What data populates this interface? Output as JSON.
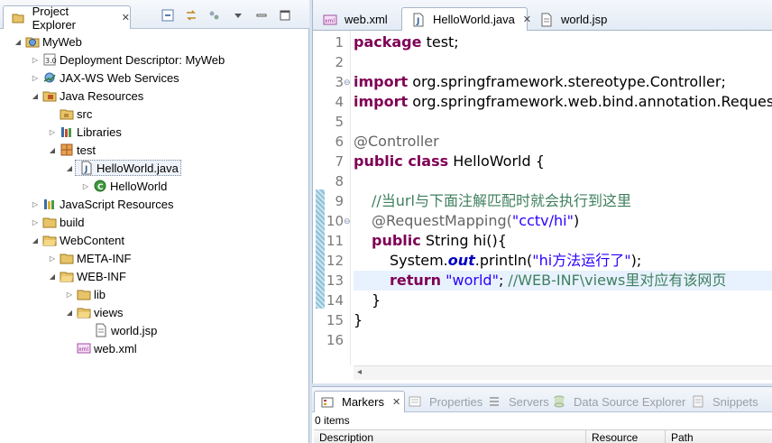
{
  "explorer": {
    "tab_title": "Project Explorer",
    "tree": [
      {
        "label": "MyWeb",
        "icon": "web-project-icon"
      },
      {
        "label": "Deployment Descriptor: MyWeb",
        "icon": "deployment-descriptor-icon"
      },
      {
        "label": "JAX-WS Web Services",
        "icon": "web-services-icon"
      },
      {
        "label": "Java Resources",
        "icon": "java-resources-icon"
      },
      {
        "label": "src",
        "icon": "source-folder-icon"
      },
      {
        "label": "Libraries",
        "icon": "libraries-icon"
      },
      {
        "label": "test",
        "icon": "package-icon"
      },
      {
        "label": "HelloWorld.java",
        "icon": "java-file-icon"
      },
      {
        "label": "HelloWorld",
        "icon": "class-icon"
      },
      {
        "label": "JavaScript Resources",
        "icon": "javascript-resources-icon"
      },
      {
        "label": "build",
        "icon": "folder-icon"
      },
      {
        "label": "WebContent",
        "icon": "folder-icon"
      },
      {
        "label": "META-INF",
        "icon": "folder-icon"
      },
      {
        "label": "WEB-INF",
        "icon": "folder-icon"
      },
      {
        "label": "lib",
        "icon": "folder-icon"
      },
      {
        "label": "views",
        "icon": "folder-icon"
      },
      {
        "label": "world.jsp",
        "icon": "jsp-file-icon"
      },
      {
        "label": "web.xml",
        "icon": "xml-file-icon"
      }
    ]
  },
  "editor": {
    "tabs": [
      {
        "label": "web.xml",
        "icon": "xml-file-icon"
      },
      {
        "label": "HelloWorld.java",
        "icon": "java-file-icon"
      },
      {
        "label": "world.jsp",
        "icon": "jsp-file-icon"
      }
    ],
    "line_numbers": [
      "1",
      "2",
      "3",
      "4",
      "5",
      "6",
      "7",
      "8",
      "9",
      "10",
      "11",
      "12",
      "13",
      "14",
      "15",
      "16"
    ],
    "code": {
      "l1_kw": "package",
      "l1_rest": " test;",
      "l3_kw": "import",
      "l3_rest": " org.springframework.stereotype.Controller;",
      "l4_kw": "import",
      "l4_rest": " org.springframework.web.bind.annotation.RequestMapping;",
      "l6_ann": "@Controller",
      "l7_kw": "public class",
      "l7_rest": " HelloWorld {",
      "l9_cmt": "//当url与下面注解匹配时就会执行到这里",
      "l10_ann": "@RequestMapping(",
      "l10_str": "\"cctv/hi\"",
      "l10_end": ")",
      "l11_kw": "public",
      "l11_rest": " String hi(){",
      "l12_pre": "System.",
      "l12_fld": "out",
      "l12_mid": ".println(",
      "l12_str": "\"hi方法运行了\"",
      "l12_end": ");",
      "l13_kw": "return",
      "l13_sp": " ",
      "l13_str": "\"world\"",
      "l13_semi": "; ",
      "l13_cmt": "//WEB-INF\\views里对应有该网页",
      "l14": "}",
      "l15": "}"
    }
  },
  "bottom": {
    "tabs": [
      {
        "label": "Markers",
        "icon": "markers-icon"
      },
      {
        "label": "Properties",
        "icon": "properties-icon"
      },
      {
        "label": "Servers",
        "icon": "servers-icon"
      },
      {
        "label": "Data Source Explorer",
        "icon": "data-source-icon"
      },
      {
        "label": "Snippets",
        "icon": "snippets-icon"
      }
    ],
    "items_count": "0 items",
    "columns": [
      "Description",
      "Resource",
      "Path"
    ]
  }
}
